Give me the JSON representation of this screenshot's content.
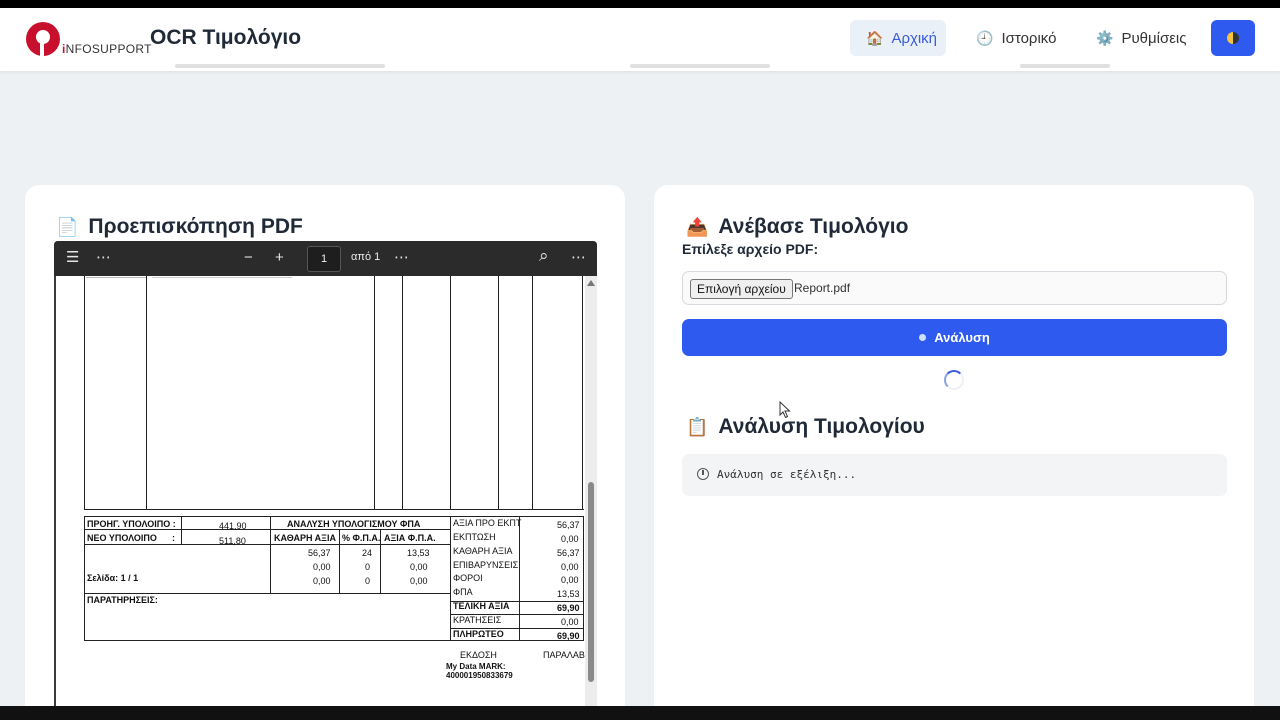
{
  "header": {
    "logo_text_i": "i",
    "logo_text": "NFOSUPPORT",
    "app_title": "OCR Τιμολόγιο",
    "nav": [
      {
        "label": "Αρχική",
        "icon": "home-icon",
        "glyph": "🏠"
      },
      {
        "label": "Ιστορικό",
        "icon": "clock-icon",
        "glyph": "🕘"
      },
      {
        "label": "Ρυθμίσεις",
        "icon": "gear-icon",
        "glyph": "⚙️"
      }
    ],
    "theme_icon": "theme-toggle-icon"
  },
  "preview": {
    "title": "Προεπισκόπηση PDF",
    "title_glyph": "📄",
    "toolbar": {
      "page_value": "1",
      "page_of": "από 1",
      "minus": "−",
      "plus": "+",
      "menu_glyph": "☰",
      "more_glyph": "⋯",
      "search_glyph": "⌕",
      "overflow_glyph": "⋯"
    },
    "invoice": {
      "prev_balance_label": "ΠΡΟΗΓ. ΥΠΟΛΟΙΠΟ :",
      "prev_balance": "441,90",
      "new_balance_label": "ΝΕΟ ΥΠΟΛΟΙΠΟ",
      "new_balance_colon": ":",
      "new_balance": "511,80",
      "vat_analysis_title": "ΑΝΑΛΥΣΗ ΥΠΟΛΟΓΙΣΜΟΥ ΦΠΑ",
      "vat_cols": [
        "ΚΑΘΑΡΗ ΑΞΙΑ",
        "% Φ.Π.Α.",
        "ΑΞΙΑ Φ.Π.Α."
      ],
      "vat_rows": [
        [
          "56,37",
          "24",
          "13,53"
        ],
        [
          "0,00",
          "0",
          "0,00"
        ],
        [
          "0,00",
          "0",
          "0,00"
        ]
      ],
      "page_label": "Σελίδα: 1 / 1",
      "remarks_label": "ΠΑΡΑΤΗΡΗΣΕΙΣ:",
      "summary": [
        {
          "label": "ΑΞΙΑ ΠΡΟ ΕΚΠΤ",
          "value": "56,37",
          "bold": false
        },
        {
          "label": "ΕΚΠΤΩΣΗ",
          "value": "0,00",
          "bold": false
        },
        {
          "label": "ΚΑΘΑΡΗ ΑΞΙΑ",
          "value": "56,37",
          "bold": false
        },
        {
          "label": "ΕΠΙΒΑΡΥΝΣΕΙΣ",
          "value": "0,00",
          "bold": false
        },
        {
          "label": "ΦΟΡΟΙ",
          "value": "0,00",
          "bold": false
        },
        {
          "label": "ΦΠΑ",
          "value": "13,53",
          "bold": false
        },
        {
          "label": "ΤΕΛΙΚΗ ΑΞΙΑ",
          "value": "69,90",
          "bold": true
        },
        {
          "label": "ΚΡΑΤΗΣΕΙΣ",
          "value": "0,00",
          "bold": false
        },
        {
          "label": "ΠΛΗΡΩΤΕΟ",
          "value": "69,90",
          "bold": true
        }
      ],
      "issue_label": "ΕΚΔΟΣΗ",
      "receive_label": "ΠΑΡΑΛΑΒ",
      "mark_label": "My Data MARK:",
      "mark_value": "400001950833679"
    }
  },
  "upload": {
    "title": "Ανέβασε Τιμολόγιο",
    "title_glyph": "📤",
    "field_label": "Επίλεξε αρχείο PDF:",
    "file_button": "Επιλογή αρχείου",
    "file_name": "Report.pdf",
    "analyze_button": "Ανάλυση"
  },
  "analysis": {
    "title": "Ανάλυση Τιμολογίου",
    "title_glyph": "📋",
    "status_text": "Ανάλυση σε εξέλιξη..."
  },
  "colors": {
    "accent": "#2f5af0",
    "brand": "#c8102e",
    "background": "#eef1f4"
  }
}
